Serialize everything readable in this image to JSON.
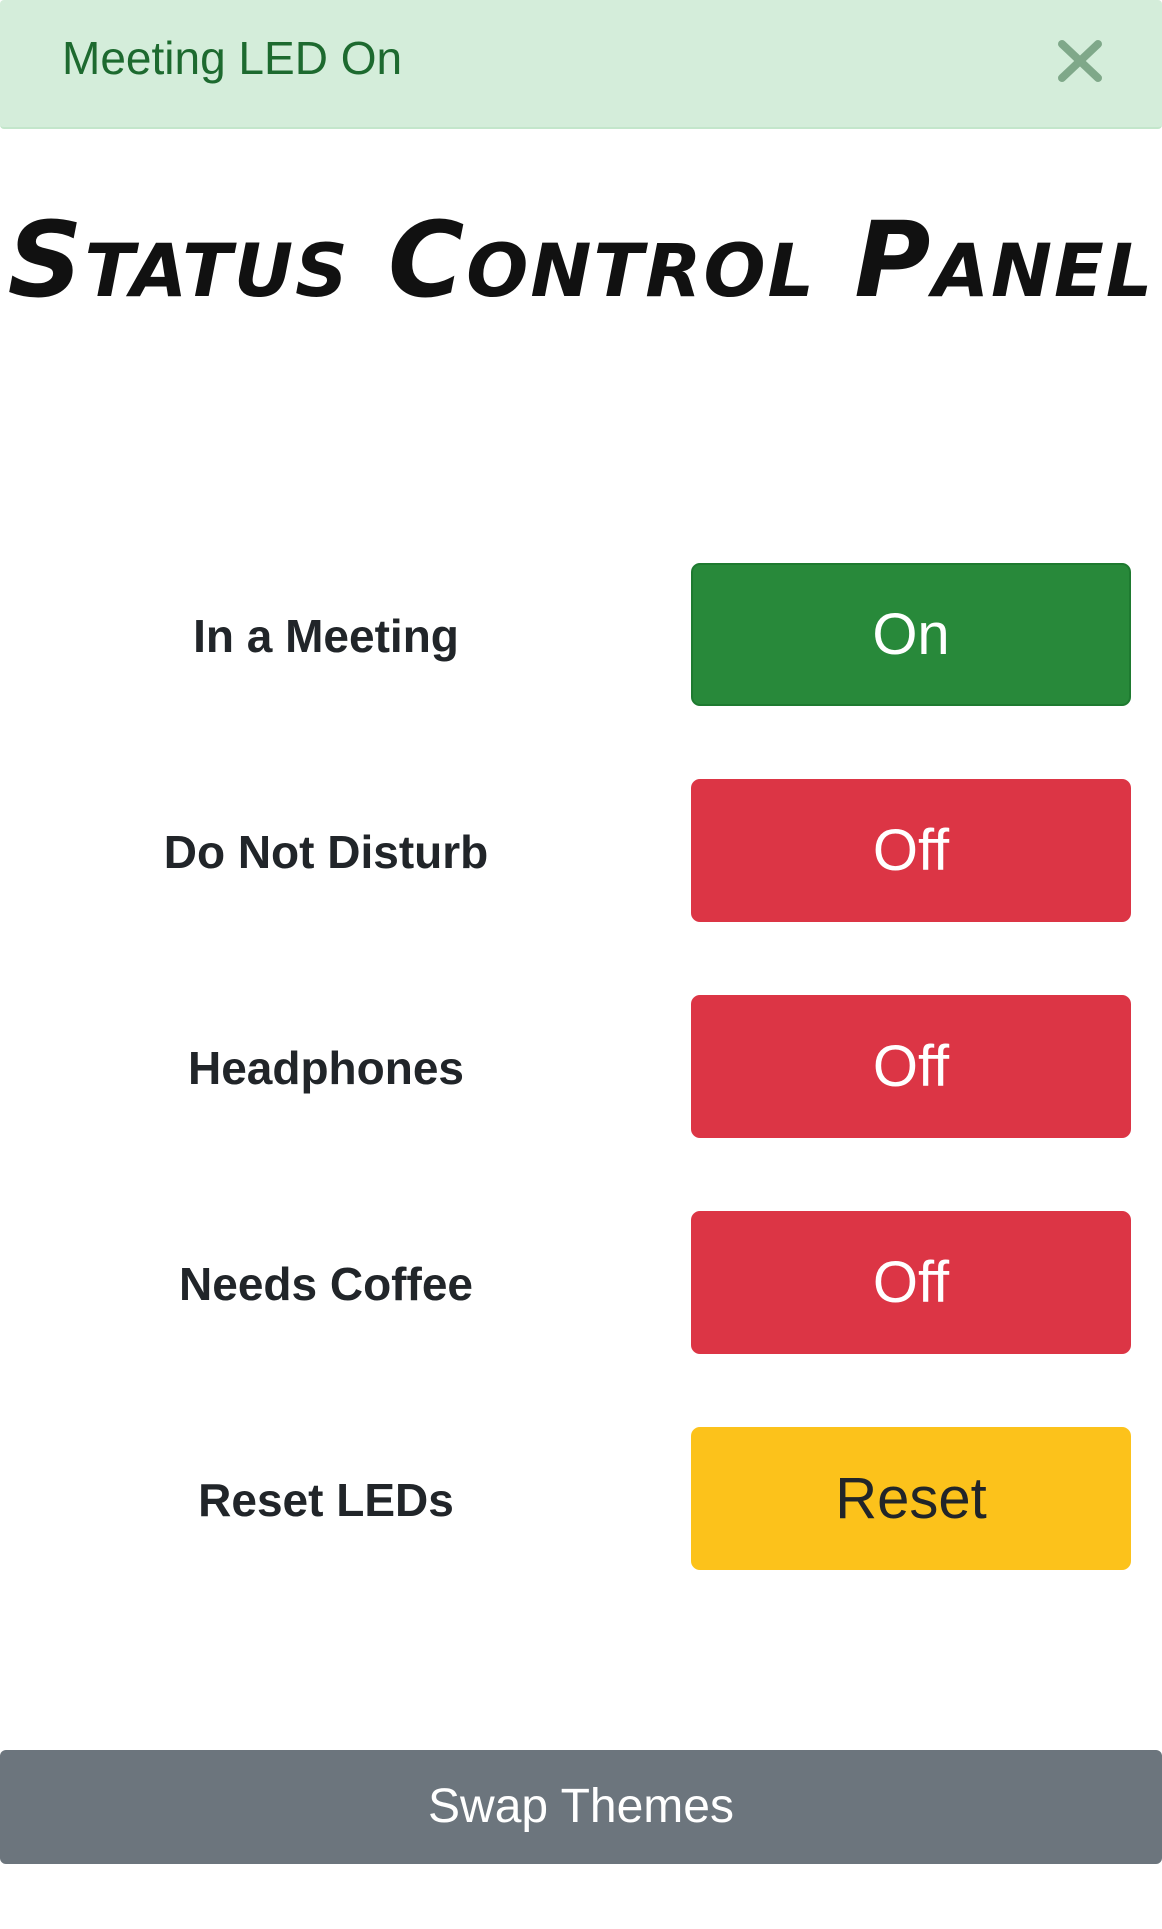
{
  "alert": {
    "message": "Meeting LED On",
    "close_icon": "close-icon",
    "color": "#d4edda",
    "text_color": "#1d6a2f"
  },
  "page": {
    "title": "Status Control Panel"
  },
  "controls": [
    {
      "label": "In a Meeting",
      "button": "On",
      "state": "on",
      "color": "#28893a"
    },
    {
      "label": "Do Not Disturb",
      "button": "Off",
      "state": "off",
      "color": "#dc3545"
    },
    {
      "label": "Headphones",
      "button": "Off",
      "state": "off",
      "color": "#dc3545"
    },
    {
      "label": "Needs Coffee",
      "button": "Off",
      "state": "off",
      "color": "#dc3545"
    },
    {
      "label": "Reset LEDs",
      "button": "Reset",
      "state": "reset",
      "color": "#fcc21b"
    }
  ],
  "footer": {
    "swap_label": "Swap Themes",
    "color": "#6c757d"
  }
}
